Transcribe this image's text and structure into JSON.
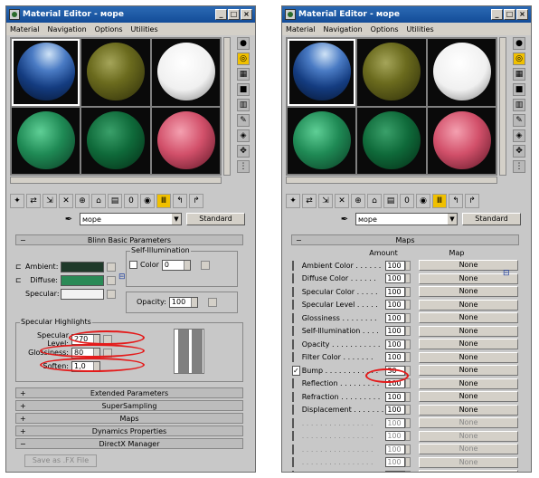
{
  "window_title": "Material Editor - море",
  "menu": [
    "Material",
    "Navigation",
    "Options",
    "Utilities"
  ],
  "material_name": "море",
  "material_type": "Standard",
  "spheres": [
    "#1f4ea0",
    "#6b6b1e",
    "#f4f4f4",
    "#1f8a55",
    "#0f6a3a",
    "#d2506a"
  ],
  "left": {
    "rollout_title": "Blinn Basic Parameters",
    "self_illum_label": "Self-Illumination",
    "color_label": "Color",
    "color_value": "0",
    "ambient_label": "Ambient:",
    "diffuse_label": "Diffuse:",
    "specular_label": "Specular:",
    "ambient_color": "#1f3a2a",
    "diffuse_color": "#2a8a56",
    "specular_color": "#f2f2f2",
    "opacity_label": "Opacity:",
    "opacity_value": "100",
    "spec_highlights_label": "Specular Highlights",
    "spec_level_label": "Specular Level:",
    "spec_level_value": "270",
    "glossiness_label": "Glossiness:",
    "glossiness_value": "80",
    "soften_label": "Soften:",
    "soften_value": "1,0",
    "rollouts": [
      "Extended Parameters",
      "SuperSampling",
      "Maps",
      "Dynamics Properties",
      "DirectX Manager"
    ],
    "save_fx_label": "Save as .FX File"
  },
  "right": {
    "maps_title": "Maps",
    "amount_header": "Amount",
    "map_header": "Map",
    "rows": [
      {
        "label": "Ambient Color . . . . . .",
        "amount": "100",
        "map": "None",
        "checked": false,
        "enabled": true
      },
      {
        "label": "Diffuse Color . . . . . .",
        "amount": "100",
        "map": "None",
        "checked": false,
        "enabled": true
      },
      {
        "label": "Specular Color . . . . .",
        "amount": "100",
        "map": "None",
        "checked": false,
        "enabled": true
      },
      {
        "label": "Specular Level . . . . .",
        "amount": "100",
        "map": "None",
        "checked": false,
        "enabled": true
      },
      {
        "label": "Glossiness . . . . . . . .",
        "amount": "100",
        "map": "None",
        "checked": false,
        "enabled": true
      },
      {
        "label": "Self-Illumination . . . .",
        "amount": "100",
        "map": "None",
        "checked": false,
        "enabled": true
      },
      {
        "label": "Opacity . . . . . . . . . . .",
        "amount": "100",
        "map": "None",
        "checked": false,
        "enabled": true
      },
      {
        "label": "Filter Color . . . . . . .",
        "amount": "100",
        "map": "None",
        "checked": false,
        "enabled": true
      },
      {
        "label": "Bump . . . . . . . . . . . .",
        "amount": "30",
        "map": "None",
        "checked": true,
        "enabled": true
      },
      {
        "label": "Reflection . . . . . . . . .",
        "amount": "100",
        "map": "None",
        "checked": false,
        "enabled": true
      },
      {
        "label": "Refraction . . . . . . . . .",
        "amount": "100",
        "map": "None",
        "checked": false,
        "enabled": true
      },
      {
        "label": "Displacement . . . . . . .",
        "amount": "100",
        "map": "None",
        "checked": false,
        "enabled": true
      },
      {
        "label": ". . . . . . . . . . . . . . . .",
        "amount": "100",
        "map": "None",
        "checked": false,
        "enabled": false
      },
      {
        "label": ". . . . . . . . . . . . . . . .",
        "amount": "100",
        "map": "None",
        "checked": false,
        "enabled": false
      },
      {
        "label": ". . . . . . . . . . . . . . . .",
        "amount": "100",
        "map": "None",
        "checked": false,
        "enabled": false
      },
      {
        "label": ". . . . . . . . . . . . . . . .",
        "amount": "100",
        "map": "None",
        "checked": false,
        "enabled": false
      },
      {
        "label": ". . . . . . . . . . . . . . . .",
        "amount": "100",
        "map": "None",
        "checked": false,
        "enabled": false
      }
    ]
  }
}
